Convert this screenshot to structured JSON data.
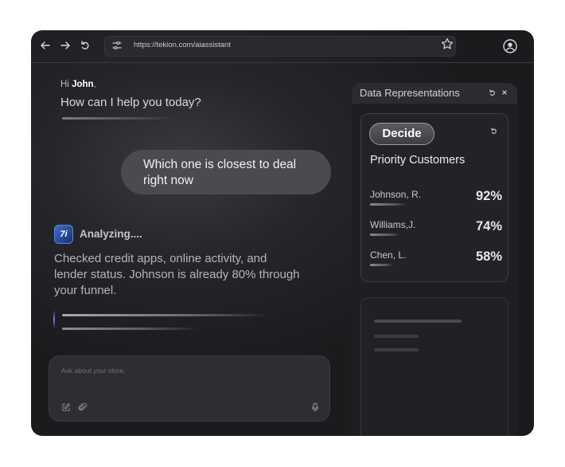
{
  "browser": {
    "url": "https://tekion.com/aiassistant",
    "icons": [
      "back-arrow-icon",
      "forward-arrow-icon",
      "reload-icon",
      "tune-icon",
      "star-icon",
      "profile-icon"
    ]
  },
  "chat": {
    "greeting_hi": "Hi ",
    "greeting_name": "John",
    "greeting_comma": ",",
    "greeting_question": "How can I help you today?",
    "user_message": "Which one is closest to deal right now",
    "assistant_logo": "7i",
    "assistant_status": "Analyzing....",
    "assistant_text": "Checked credit apps, online activity, and lender status. Johnson is already 80% through your funnel.",
    "input_placeholder": "Ask about your store."
  },
  "panel": {
    "title": "Data Representations",
    "decide_label": "Decide",
    "card_title": "Priority Customers",
    "customers": [
      {
        "name": "Johnson, R.",
        "percent": "92%",
        "value": 0.92
      },
      {
        "name": "Williams,J.",
        "percent": "74%",
        "value": 0.74
      },
      {
        "name": "Chen, L.",
        "percent": "58%",
        "value": 0.58
      }
    ]
  },
  "colors": {
    "window_bg": "#1b1b1e",
    "accent_purple": "#8a6cff",
    "logo_blue": "#3b6fd6"
  }
}
